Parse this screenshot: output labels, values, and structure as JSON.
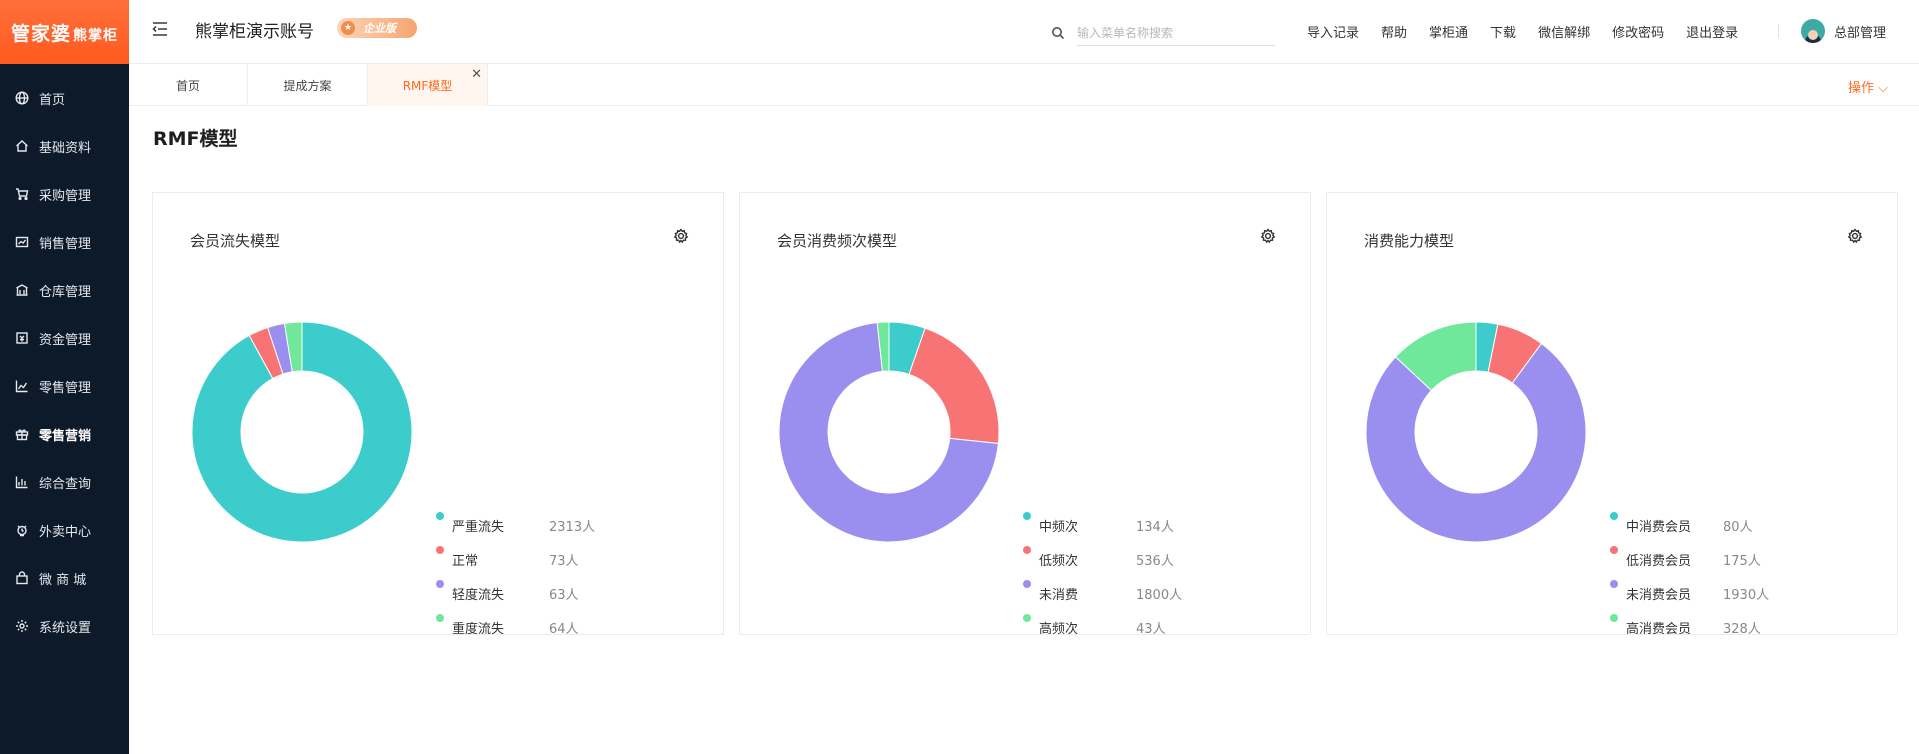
{
  "brand": {
    "logo_main": "管家婆",
    "logo_sub": "熊掌柜"
  },
  "sidebar": {
    "items": [
      {
        "label": "首页",
        "icon": "globe-icon"
      },
      {
        "label": "基础资料",
        "icon": "home-icon"
      },
      {
        "label": "采购管理",
        "icon": "cart-icon"
      },
      {
        "label": "销售管理",
        "icon": "sales-icon"
      },
      {
        "label": "仓库管理",
        "icon": "warehouse-icon"
      },
      {
        "label": "资金管理",
        "icon": "fund-icon"
      },
      {
        "label": "零售管理",
        "icon": "chart-icon"
      },
      {
        "label": "零售营销",
        "icon": "gift-icon"
      },
      {
        "label": "综合查询",
        "icon": "bar-chart-icon"
      },
      {
        "label": "外卖中心",
        "icon": "delivery-icon"
      },
      {
        "label": "微 商 城",
        "icon": "shop-bag-icon"
      },
      {
        "label": "系统设置",
        "icon": "gear-icon"
      }
    ],
    "active_index": 7
  },
  "header": {
    "account_name": "熊掌柜演示账号",
    "edition_badge": "企业版",
    "search_placeholder": "输入菜单名称搜索",
    "links": [
      "导入记录",
      "帮助",
      "掌柜通",
      "下载",
      "微信解绑",
      "修改密码",
      "退出登录"
    ],
    "user_name": "总部管理"
  },
  "tabs": {
    "items": [
      "首页",
      "提成方案",
      "RMF模型"
    ],
    "active_index": 2,
    "ops_label": "操作 ⌵"
  },
  "page": {
    "title": "RMF模型"
  },
  "colors": {
    "teal": "#3ccccb",
    "red": "#f87474",
    "purple": "#9a8eef",
    "green": "#6fe89b",
    "accent": "#ff6a1f"
  },
  "cards": [
    {
      "title": "会员流失模型",
      "chart_data": {
        "type": "pie",
        "segments": [
          {
            "name": "严重流失",
            "value": 2313,
            "display": "2313人",
            "color": "#3ccccb"
          },
          {
            "name": "正常",
            "value": 73,
            "display": "73人",
            "color": "#f87474"
          },
          {
            "name": "轻度流失",
            "value": 63,
            "display": "63人",
            "color": "#9a8eef"
          },
          {
            "name": "重度流失",
            "value": 64,
            "display": "64人",
            "color": "#6fe89b"
          }
        ]
      }
    },
    {
      "title": "会员消费频次模型",
      "chart_data": {
        "type": "pie",
        "segments": [
          {
            "name": "中频次",
            "value": 134,
            "display": "134人",
            "color": "#3ccccb"
          },
          {
            "name": "低频次",
            "value": 536,
            "display": "536人",
            "color": "#f87474"
          },
          {
            "name": "未消费",
            "value": 1800,
            "display": "1800人",
            "color": "#9a8eef"
          },
          {
            "name": "高频次",
            "value": 43,
            "display": "43人",
            "color": "#6fe89b"
          }
        ]
      }
    },
    {
      "title": "消费能力模型",
      "chart_data": {
        "type": "pie",
        "segments": [
          {
            "name": "中消费会员",
            "value": 80,
            "display": "80人",
            "color": "#3ccccb"
          },
          {
            "name": "低消费会员",
            "value": 175,
            "display": "175人",
            "color": "#f87474"
          },
          {
            "name": "未消费会员",
            "value": 1930,
            "display": "1930人",
            "color": "#9a8eef"
          },
          {
            "name": "高消费会员",
            "value": 328,
            "display": "328人",
            "color": "#6fe89b"
          }
        ]
      }
    }
  ]
}
